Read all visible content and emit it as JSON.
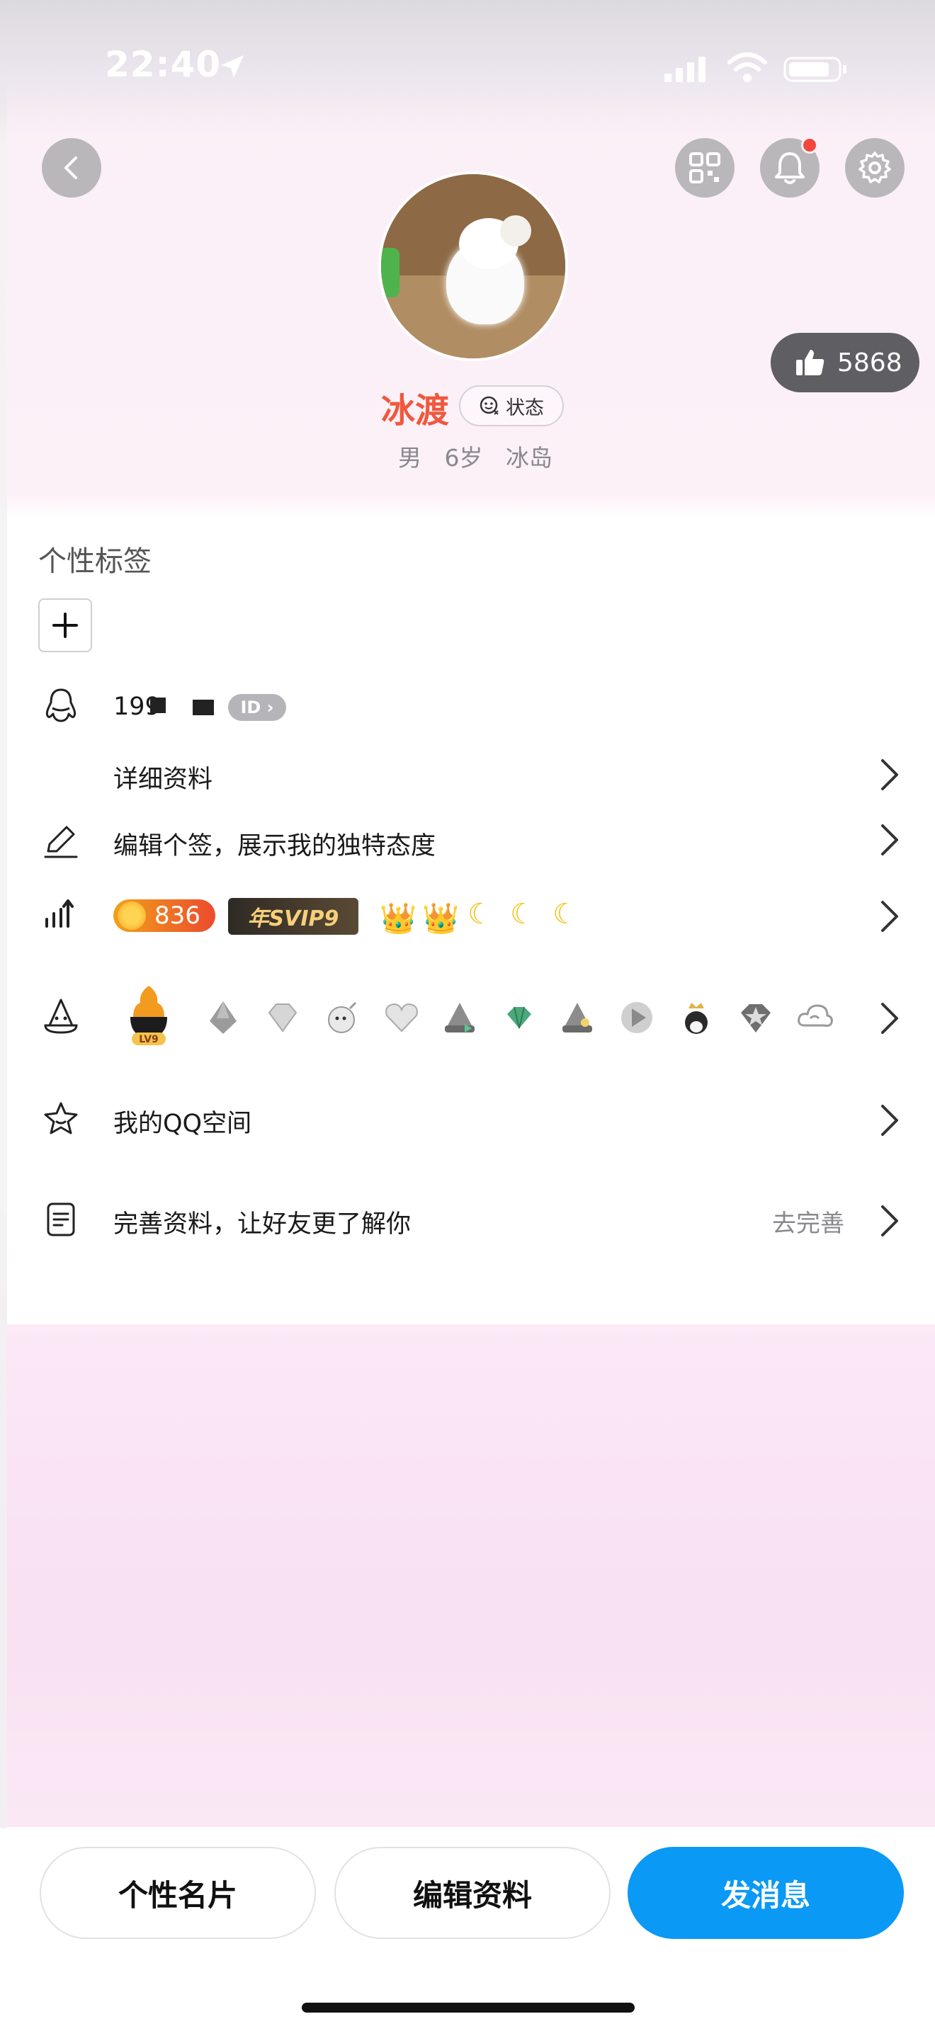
{
  "status_bar": {
    "time": "22:40"
  },
  "header": {
    "like_count": "5868",
    "notification_dot_color": "#f2473a"
  },
  "profile": {
    "name": "冰渡",
    "status_label": "状态",
    "gender": "男",
    "age": "6岁",
    "location": "冰岛",
    "name_color": "#f0583d"
  },
  "tags": {
    "title": "个性标签",
    "add_icon": "plus-icon"
  },
  "rows": {
    "qq_number": "199",
    "id_badge": "ID",
    "detail_label": "详细资料",
    "signature_placeholder": "编辑个签，展示我的独特态度",
    "level_value": "836",
    "svip_label": "年SVIP9",
    "lv9_label": "LV9",
    "qzone_label": "我的QQ空间",
    "complete_label": "完善资料，让好友更了解你",
    "complete_action": "去完善"
  },
  "bottom": {
    "card_label": "个性名片",
    "edit_label": "编辑资料",
    "send_label": "发消息",
    "send_color": "#0a99f5"
  }
}
